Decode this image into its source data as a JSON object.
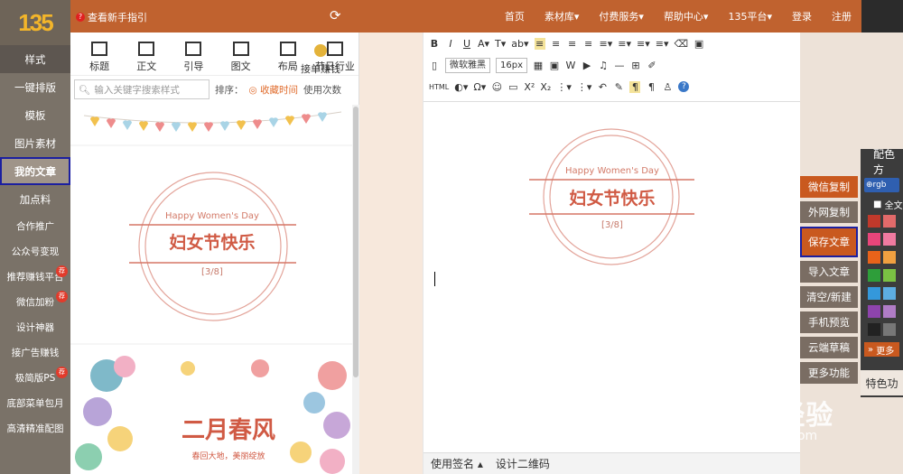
{
  "topbar": {
    "logo": "135",
    "guide": "查看新手指引",
    "nav": [
      "首页",
      "素材库▾",
      "付费服务▾",
      "帮助中心▾",
      "135平台▾",
      "登录",
      "注册"
    ]
  },
  "leftnav": {
    "items": [
      {
        "label": "样式"
      },
      {
        "label": "一键排版"
      },
      {
        "label": "模板"
      },
      {
        "label": "图片素材"
      },
      {
        "label": "我的文章"
      },
      {
        "label": "加点料"
      },
      {
        "label": "合作推广"
      },
      {
        "label": "公众号变现"
      },
      {
        "label": "推荐赚钱平台",
        "badge": "荐"
      },
      {
        "label": "微信加粉",
        "badge": "荐"
      },
      {
        "label": "设计神器"
      },
      {
        "label": "接广告赚钱"
      },
      {
        "label": "极简版PS",
        "badge": "荐"
      },
      {
        "label": "底部菜单包月"
      },
      {
        "label": "高清精准配图"
      }
    ]
  },
  "tools": [
    "标题",
    "正文",
    "引导",
    "图文",
    "布局",
    "节日行业"
  ],
  "tool_special": "接单赚钱",
  "search": {
    "placeholder": "输入关键字搜索样式",
    "sort_label": "排序：",
    "sort_time": "◎ 收藏时间",
    "sort_count": "使用次数"
  },
  "cards": {
    "womens_day": {
      "en": "Happy Women's Day",
      "cn": "妇女节快乐",
      "date": "[3/8]"
    },
    "spring": {
      "title": "二月春风",
      "sub": "春回大地，美丽绽放"
    }
  },
  "editor": {
    "toolbar1": [
      "B",
      "I",
      "U",
      "A▾",
      "T▾",
      "ab▾",
      "≡",
      "≡",
      "≡",
      "≡",
      "≡▾",
      "≡▾",
      "≡▾",
      "≡▾",
      "⌫",
      "▣"
    ],
    "font": "微软雅黑",
    "size": "16px",
    "toolbar3": [
      "HTML",
      "◐▾",
      "Ω▾",
      "☺",
      "▭",
      "X²",
      "X₂",
      "⋮▾",
      "⋮▾",
      "↶",
      "✎",
      "¶",
      "¶",
      "♙",
      "?"
    ],
    "canvas": {
      "en": "Happy Women's Day",
      "cn": "妇女节快乐",
      "date": "[3/8]"
    },
    "bottom": [
      "使用签名 ▴",
      "设计二维码"
    ]
  },
  "right_buttons": [
    "微信复制",
    "外网复制",
    "保存文章",
    "导入文章",
    "清空/新建",
    "手机预览",
    "云端草稿",
    "更多功能"
  ],
  "color_panel": {
    "title": "配色方",
    "input_text": "rgb",
    "checkbox": "全文",
    "more": "更多",
    "special": "特色功",
    "colors": [
      "#c0392b",
      "#e8457a",
      "#e8631a",
      "#2e9e3a",
      "#3498db",
      "#8e44ad",
      "#333333"
    ]
  },
  "watermark": {
    "line1": "Baidu经验",
    "line2": "jingyan.baidu.com"
  }
}
